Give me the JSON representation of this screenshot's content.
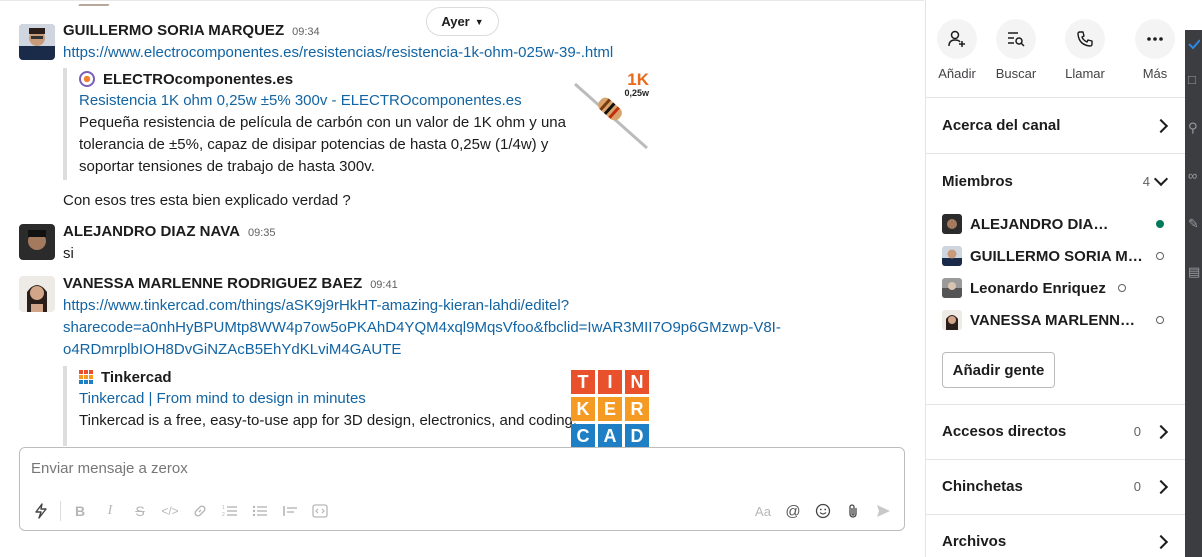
{
  "chat": {
    "date_divider": "Ayer",
    "messages": [
      {
        "author": "GUILLERMO SORIA MARQUEZ",
        "time": "09:34",
        "link": "https://www.electrocomponentes.es/resistencias/resistencia-1k-ohm-025w-39-.html",
        "unfurl": {
          "site": "ELECTROcomponentes.es",
          "title": "Resistencia 1K ohm 0,25w ±5% 300v - ELECTROcomponentes.es",
          "desc_lines": [
            "Pequeña resistencia de película de carbón con un valor de 1K ohm y una",
            "tolerancia de ±5%, capaz de disipar potencias de hasta 0,25w (1/4w) y",
            "soportar tensiones de trabajo de hasta 300v."
          ],
          "thumb_label_big": "1K",
          "thumb_label_small": "0,25w"
        },
        "followup": "Con esos tres esta bien explicado verdad ?"
      },
      {
        "author": "ALEJANDRO DIAZ NAVA",
        "time": "09:35",
        "text": "si"
      },
      {
        "author": "VANESSA MARLENNE RODRIGUEZ BAEZ",
        "time": "09:41",
        "link_lines": [
          "https://www.tinkercad.com/things/aSK9j9rHkHT-amazing-kieran-lahdi/editel?",
          "sharecode=a0nhHyBPUMtp8WW4p7ow5oPKAhD4YQM4xql9MqsVfoo&fbclid=IwAR3MII7O9p6GMzwp-V8I-",
          "o4RDmrplbIOH8DvGiNZAcB5EhYdKLviM4GAUTE"
        ],
        "unfurl": {
          "site": "Tinkercad",
          "title": "Tinkercad | From mind to design in minutes",
          "desc": "Tinkercad is a free, easy-to-use app for 3D design, electronics, and coding.",
          "logo_letters": [
            "T",
            "I",
            "N",
            "K",
            "E",
            "R",
            "C",
            "A",
            "D"
          ]
        }
      }
    ]
  },
  "composer": {
    "placeholder": "Enviar mensaje a zerox"
  },
  "panel": {
    "actions": [
      {
        "label": "Añadir",
        "icon": "add-person-icon"
      },
      {
        "label": "Buscar",
        "icon": "search-list-icon"
      },
      {
        "label": "Llamar",
        "icon": "phone-icon"
      },
      {
        "label": "Más",
        "icon": "more-icon"
      }
    ],
    "about": "Acerca del canal",
    "members_title": "Miembros",
    "members_count": "4",
    "members": [
      {
        "name": "ALEJANDRO DIAZ NAVA",
        "online": true
      },
      {
        "name": "GUILLERMO SORIA MARQUEZ",
        "online": false
      },
      {
        "name": "Leonardo Enriquez",
        "online": false
      },
      {
        "name": "VANESSA MARLENNE RODRIGUEZ BAEZ",
        "online": false
      }
    ],
    "add_people": "Añadir gente",
    "shortcuts": "Accesos directos",
    "shortcuts_count": "0",
    "pins": "Chinchetas",
    "pins_count": "0",
    "files": "Archivos"
  },
  "colors": {
    "link": "#1264a3",
    "online": "#007a5a",
    "tinkercad": [
      "#e8512b",
      "#e8512b",
      "#e8512b",
      "#f59a23",
      "#f59a23",
      "#f59a23",
      "#1f7fc4",
      "#1f7fc4",
      "#1f7fc4"
    ]
  }
}
